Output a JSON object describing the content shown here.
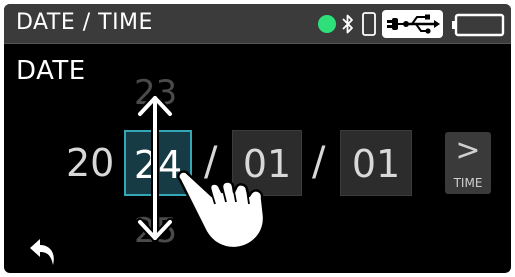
{
  "header": {
    "title": "DATE / TIME",
    "status_color": "#2fe07a",
    "icons": [
      "bluetooth-icon",
      "phone-icon",
      "usb-power-icon",
      "battery-icon"
    ]
  },
  "section": {
    "label": "DATE"
  },
  "date": {
    "century": "20",
    "year": "24",
    "year_prev": "23",
    "year_next": "25",
    "separator": "/",
    "month": "01",
    "day": "01",
    "accent_color": "#34a6b6"
  },
  "next_button": {
    "arrow": ">",
    "label": "TIME"
  },
  "gesture": {
    "icon": "swipe-up-down-hand-icon"
  }
}
